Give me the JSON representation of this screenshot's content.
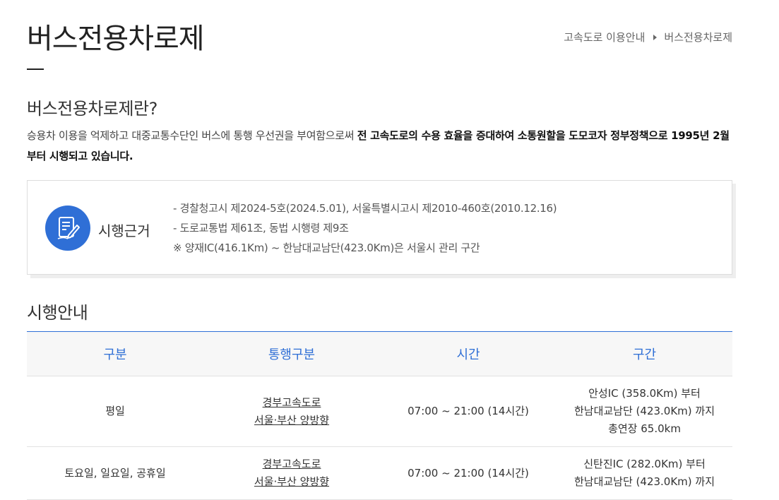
{
  "page": {
    "title": "버스전용차로제"
  },
  "breadcrumb": {
    "parent": "고속도로 이용안내",
    "current": "버스전용차로제"
  },
  "intro": {
    "heading": "버스전용차로제란?",
    "text_plain": "승용차 이용을 억제하고 대중교통수단인 버스에 통행 우선권을 부여함으로써 ",
    "text_bold": "전 고속도로의 수용 효율을 증대하여 소통원할을 도모코자 정부정책으로 1995년 2월부터 시행되고 있습니다."
  },
  "basis": {
    "icon": "document-pen-icon",
    "label": "시행근거",
    "lines": [
      "- 경찰청고시 제2024-5호(2024.5.01), 서울특별시고시 제2010-460호(2010.12.16)",
      "- 도로교통법 제61조, 동법 시행령 제9조",
      "※ 양재IC(416.1Km) ~ 한남대교남단(423.0Km)은 서울시 관리 구간"
    ]
  },
  "guide": {
    "heading": "시행안내",
    "columns": [
      "구분",
      "통행구분",
      "시간",
      "구간"
    ],
    "rows": [
      {
        "category": "평일",
        "route": [
          "경부고속도로",
          "서울·부산 양방향"
        ],
        "time": "07:00 ~ 21:00 (14시간)",
        "section": [
          "안성IC (358.0Km) 부터",
          "한남대교남단 (423.0Km) 까지",
          "총연장 65.0km"
        ]
      },
      {
        "category": "토요일, 일요일, 공휴일",
        "route": [
          "경부고속도로",
          "서울·부산 양방향"
        ],
        "time": "07:00 ~ 21:00 (14시간)",
        "section": [
          "신탄진IC (282.0Km) 부터",
          "한남대교남단 (423.0Km) 까지"
        ]
      }
    ]
  },
  "colors": {
    "accent": "#2f6fd6",
    "text": "#222222"
  }
}
